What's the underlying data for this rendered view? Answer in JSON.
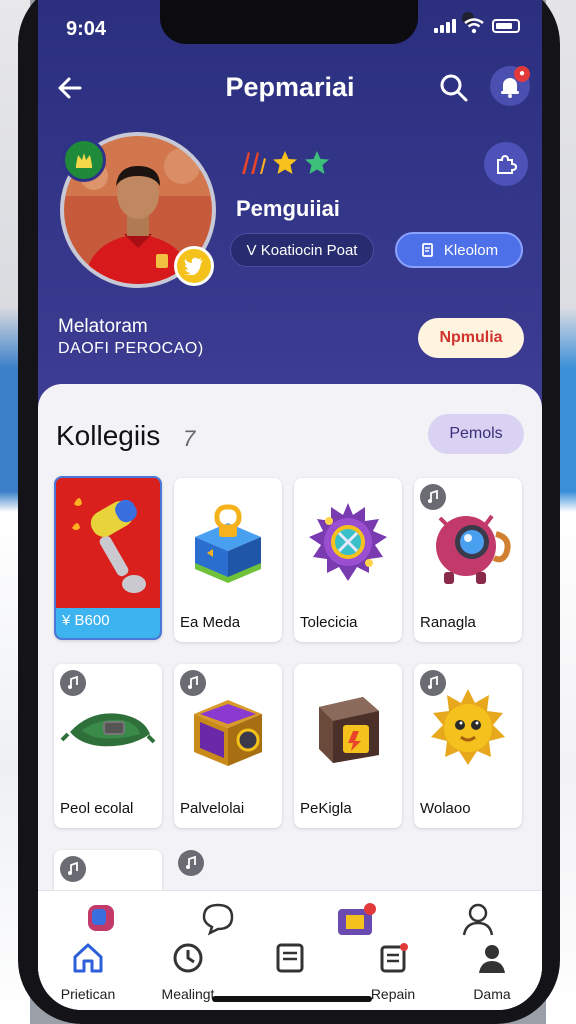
{
  "status": {
    "time": "9:04"
  },
  "header": {
    "title": "Pepmariai"
  },
  "profile": {
    "name": "Pemguiiai",
    "pill_dark": "V Koatiocin Poat",
    "pill_blue": "Kleolom",
    "meta_line1": "Melatoram",
    "meta_line2": "DAOFI PEROCAO)",
    "action_pill": "Npmulia"
  },
  "collection": {
    "title": "Kollegiis",
    "title_mark": "7",
    "filter_pill": "Pemols",
    "items": [
      {
        "label": "¥ B600",
        "icon": "hammer-icon"
      },
      {
        "label": "Ea Meda",
        "icon": "blue-chest-icon"
      },
      {
        "label": "Tolecicia",
        "icon": "spiked-gem-icon"
      },
      {
        "label": "Ranagla",
        "icon": "robot-orb-icon"
      },
      {
        "label": "Peol ecolal",
        "icon": "turtle-icon"
      },
      {
        "label": "Palvelolai",
        "icon": "purple-chest-icon"
      },
      {
        "label": "PeKigla",
        "icon": "brown-box-icon"
      },
      {
        "label": "Wolaoo",
        "icon": "sun-face-icon"
      }
    ]
  },
  "nav": {
    "items": [
      {
        "label": "Prietican",
        "icon": "home-icon"
      },
      {
        "label": "Mealingt",
        "icon": "clock-icon"
      },
      {
        "label": "",
        "icon": "tablet-icon"
      },
      {
        "label": "Repain",
        "icon": "clipboard-icon"
      },
      {
        "label": "Dama",
        "icon": "user-icon"
      }
    ]
  },
  "colors": {
    "header": "#2e3288",
    "accent_blue": "#4d6fe8",
    "selected_card": "#d9201c"
  }
}
